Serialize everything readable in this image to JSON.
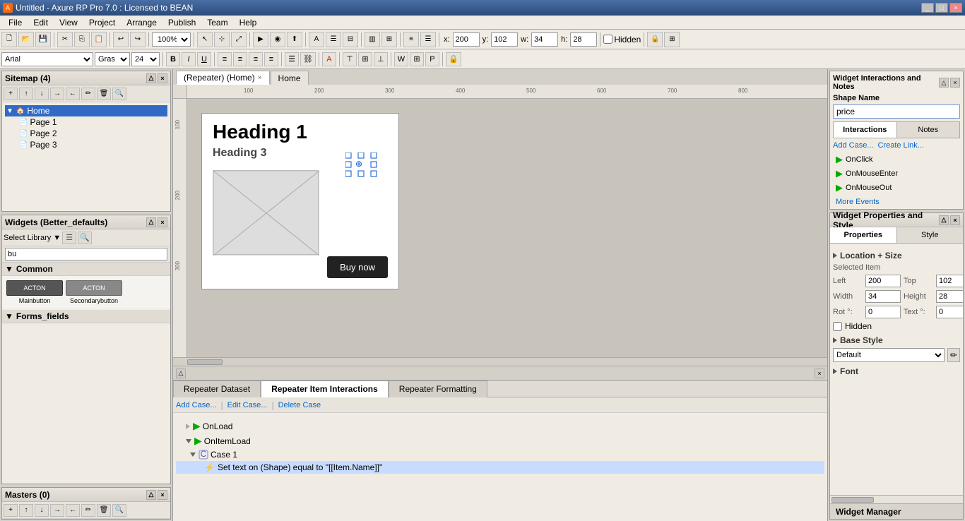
{
  "titleBar": {
    "title": "Untitled - Axure RP Pro 7.0 : Licensed to BEAN",
    "icon": "A",
    "controls": [
      "_",
      "□",
      "×"
    ]
  },
  "menuBar": {
    "items": [
      "File",
      "Edit",
      "View",
      "Project",
      "Arrange",
      "Publish",
      "Team",
      "Help"
    ]
  },
  "toolbar1": {
    "zoom": "100%",
    "coords": {
      "x_label": "x:",
      "x_val": "200",
      "y_label": "y:",
      "y_val": "102",
      "w_label": "w:",
      "w_val": "34",
      "h_label": "h:",
      "h_val": "28"
    },
    "hidden_label": "Hidden"
  },
  "toolbar2": {
    "font": "Arial",
    "style": "Gras",
    "size": "24"
  },
  "sitemap": {
    "title": "Sitemap (4)",
    "tree": {
      "home": "Home",
      "pages": [
        "Page 1",
        "Page 2",
        "Page 3"
      ]
    }
  },
  "widgets": {
    "title": "Widgets (Better_defaults)",
    "search_placeholder": "bu",
    "category": "Common",
    "items": [
      {
        "label": "Mainbutton",
        "btn_text": "ACTON"
      },
      {
        "label": "Secondarybutton",
        "btn_text": "ACTON"
      }
    ],
    "category2": "Forms_fields"
  },
  "masters": {
    "title": "Masters (0)"
  },
  "canvasTabs": [
    {
      "label": "(Repeater) (Home)",
      "active": true,
      "closable": true
    },
    {
      "label": "Home",
      "active": false,
      "closable": false
    }
  ],
  "canvasContent": {
    "heading1": "Heading 1",
    "heading3": "Heading 3",
    "buyButton": "Buy now"
  },
  "repeaterPanel": {
    "tabs": [
      {
        "label": "Repeater Dataset",
        "active": false
      },
      {
        "label": "Repeater Item Interactions",
        "active": true
      },
      {
        "label": "Repeater Formatting",
        "active": false
      }
    ],
    "toolbar": {
      "addCase": "Add Case...",
      "editCase": "Edit Case...",
      "deleteCase": "Delete Case"
    },
    "events": [
      {
        "name": "OnLoad",
        "indent": 0,
        "type": "event"
      },
      {
        "name": "OnItemLoad",
        "indent": 0,
        "type": "event",
        "expanded": true
      },
      {
        "name": "Case 1",
        "indent": 1,
        "type": "case",
        "expanded": true
      },
      {
        "name": "Set text on (Shape) equal to \"[[Item.Name]]\"",
        "indent": 2,
        "type": "action",
        "selected": true
      }
    ]
  },
  "rightPanelTop": {
    "title": "Widget Interactions and Notes",
    "shapeNameLabel": "Shape Name",
    "shapeNameValue": "price",
    "tabs": [
      "Interactions",
      "Notes"
    ],
    "activeTab": "Interactions",
    "links": [
      "Add Case...",
      "Create Link..."
    ],
    "events": [
      "OnClick",
      "OnMouseEnter",
      "OnMouseOut"
    ],
    "moreEvents": "More Events"
  },
  "rightPanelBottom": {
    "title": "Widget Properties and Style",
    "tabs": [
      "Properties",
      "Style"
    ],
    "activeTab": "Properties",
    "sections": {
      "locationSize": {
        "label": "Location + Size",
        "selectedItem": "Selected Item",
        "left_label": "Left",
        "left_val": "200",
        "top_label": "Top",
        "top_val": "102",
        "width_label": "Width",
        "width_val": "34",
        "height_label": "Height",
        "height_val": "28",
        "rot_label": "Rot °:",
        "rot_val": "0",
        "text_label": "Text °:",
        "text_val": "0",
        "hidden_label": "Hidden"
      },
      "baseStyle": {
        "label": "Base Style",
        "value": "Default"
      },
      "font": {
        "label": "Font"
      }
    },
    "widgetManager": "Widget Manager"
  }
}
